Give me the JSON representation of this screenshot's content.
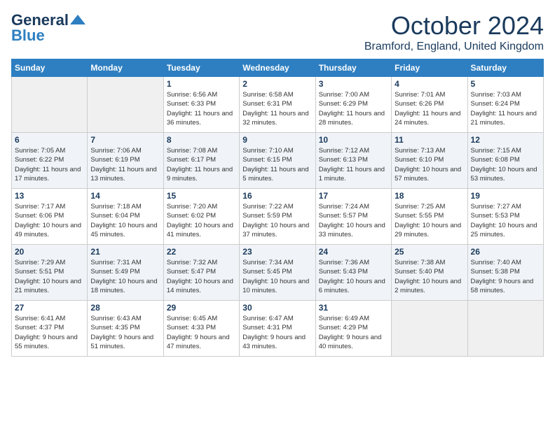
{
  "header": {
    "logo_line1": "General",
    "logo_line2": "Blue",
    "title": "October 2024",
    "subtitle": "Bramford, England, United Kingdom"
  },
  "days_of_week": [
    "Sunday",
    "Monday",
    "Tuesday",
    "Wednesday",
    "Thursday",
    "Friday",
    "Saturday"
  ],
  "weeks": [
    [
      {
        "day": "",
        "detail": ""
      },
      {
        "day": "",
        "detail": ""
      },
      {
        "day": "1",
        "detail": "Sunrise: 6:56 AM\nSunset: 6:33 PM\nDaylight: 11 hours and 36 minutes."
      },
      {
        "day": "2",
        "detail": "Sunrise: 6:58 AM\nSunset: 6:31 PM\nDaylight: 11 hours and 32 minutes."
      },
      {
        "day": "3",
        "detail": "Sunrise: 7:00 AM\nSunset: 6:29 PM\nDaylight: 11 hours and 28 minutes."
      },
      {
        "day": "4",
        "detail": "Sunrise: 7:01 AM\nSunset: 6:26 PM\nDaylight: 11 hours and 24 minutes."
      },
      {
        "day": "5",
        "detail": "Sunrise: 7:03 AM\nSunset: 6:24 PM\nDaylight: 11 hours and 21 minutes."
      }
    ],
    [
      {
        "day": "6",
        "detail": "Sunrise: 7:05 AM\nSunset: 6:22 PM\nDaylight: 11 hours and 17 minutes."
      },
      {
        "day": "7",
        "detail": "Sunrise: 7:06 AM\nSunset: 6:19 PM\nDaylight: 11 hours and 13 minutes."
      },
      {
        "day": "8",
        "detail": "Sunrise: 7:08 AM\nSunset: 6:17 PM\nDaylight: 11 hours and 9 minutes."
      },
      {
        "day": "9",
        "detail": "Sunrise: 7:10 AM\nSunset: 6:15 PM\nDaylight: 11 hours and 5 minutes."
      },
      {
        "day": "10",
        "detail": "Sunrise: 7:12 AM\nSunset: 6:13 PM\nDaylight: 11 hours and 1 minute."
      },
      {
        "day": "11",
        "detail": "Sunrise: 7:13 AM\nSunset: 6:10 PM\nDaylight: 10 hours and 57 minutes."
      },
      {
        "day": "12",
        "detail": "Sunrise: 7:15 AM\nSunset: 6:08 PM\nDaylight: 10 hours and 53 minutes."
      }
    ],
    [
      {
        "day": "13",
        "detail": "Sunrise: 7:17 AM\nSunset: 6:06 PM\nDaylight: 10 hours and 49 minutes."
      },
      {
        "day": "14",
        "detail": "Sunrise: 7:18 AM\nSunset: 6:04 PM\nDaylight: 10 hours and 45 minutes."
      },
      {
        "day": "15",
        "detail": "Sunrise: 7:20 AM\nSunset: 6:02 PM\nDaylight: 10 hours and 41 minutes."
      },
      {
        "day": "16",
        "detail": "Sunrise: 7:22 AM\nSunset: 5:59 PM\nDaylight: 10 hours and 37 minutes."
      },
      {
        "day": "17",
        "detail": "Sunrise: 7:24 AM\nSunset: 5:57 PM\nDaylight: 10 hours and 33 minutes."
      },
      {
        "day": "18",
        "detail": "Sunrise: 7:25 AM\nSunset: 5:55 PM\nDaylight: 10 hours and 29 minutes."
      },
      {
        "day": "19",
        "detail": "Sunrise: 7:27 AM\nSunset: 5:53 PM\nDaylight: 10 hours and 25 minutes."
      }
    ],
    [
      {
        "day": "20",
        "detail": "Sunrise: 7:29 AM\nSunset: 5:51 PM\nDaylight: 10 hours and 21 minutes."
      },
      {
        "day": "21",
        "detail": "Sunrise: 7:31 AM\nSunset: 5:49 PM\nDaylight: 10 hours and 18 minutes."
      },
      {
        "day": "22",
        "detail": "Sunrise: 7:32 AM\nSunset: 5:47 PM\nDaylight: 10 hours and 14 minutes."
      },
      {
        "day": "23",
        "detail": "Sunrise: 7:34 AM\nSunset: 5:45 PM\nDaylight: 10 hours and 10 minutes."
      },
      {
        "day": "24",
        "detail": "Sunrise: 7:36 AM\nSunset: 5:43 PM\nDaylight: 10 hours and 6 minutes."
      },
      {
        "day": "25",
        "detail": "Sunrise: 7:38 AM\nSunset: 5:40 PM\nDaylight: 10 hours and 2 minutes."
      },
      {
        "day": "26",
        "detail": "Sunrise: 7:40 AM\nSunset: 5:38 PM\nDaylight: 9 hours and 58 minutes."
      }
    ],
    [
      {
        "day": "27",
        "detail": "Sunrise: 6:41 AM\nSunset: 4:37 PM\nDaylight: 9 hours and 55 minutes."
      },
      {
        "day": "28",
        "detail": "Sunrise: 6:43 AM\nSunset: 4:35 PM\nDaylight: 9 hours and 51 minutes."
      },
      {
        "day": "29",
        "detail": "Sunrise: 6:45 AM\nSunset: 4:33 PM\nDaylight: 9 hours and 47 minutes."
      },
      {
        "day": "30",
        "detail": "Sunrise: 6:47 AM\nSunset: 4:31 PM\nDaylight: 9 hours and 43 minutes."
      },
      {
        "day": "31",
        "detail": "Sunrise: 6:49 AM\nSunset: 4:29 PM\nDaylight: 9 hours and 40 minutes."
      },
      {
        "day": "",
        "detail": ""
      },
      {
        "day": "",
        "detail": ""
      }
    ]
  ]
}
